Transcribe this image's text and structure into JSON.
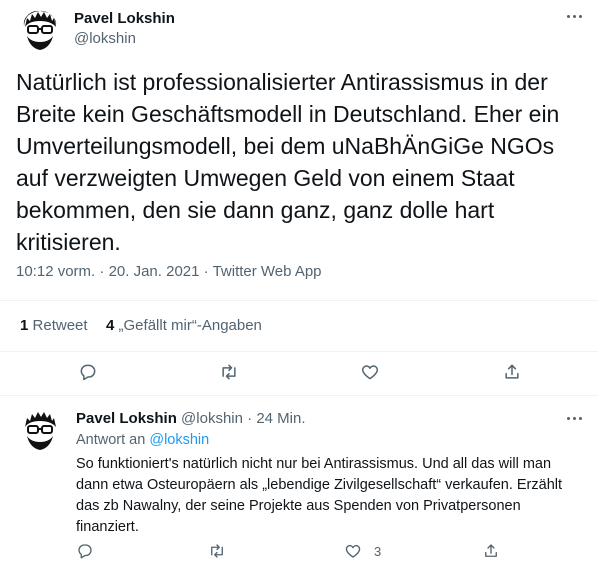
{
  "tweet": {
    "author_name": "Pavel Lokshin",
    "author_handle": "@lokshin",
    "text": "Natürlich ist professionalisierter Antirassismus in der Breite kein Geschäftsmodell in Deutschland. Eher ein Umverteilungsmodell, bei dem uNaBhÄnGiGe NGOs auf verzweigten Umwegen Geld von einem Staat bekommen, den sie dann ganz, ganz dolle hart kritisieren.",
    "time": "10:12 vorm.",
    "date": "20. Jan. 2021",
    "source": "Twitter Web App",
    "sep": "·",
    "retweet_count": "1",
    "retweet_label": "Retweet",
    "like_count": "4",
    "like_label": "„Gefällt mir“-Angaben"
  },
  "reply": {
    "author_name": "Pavel Lokshin",
    "author_handle": "@lokshin",
    "sep": "·",
    "age": "24 Min.",
    "reply_to_label": "Antwort an",
    "reply_to_handle": "@lokshin",
    "text": "So funktioniert's natürlich nicht nur bei Antirassismus. Und all das will man dann etwa Osteuropäern als „lebendige Zivilgesellschaft“ verkaufen. Erzählt das zb Nawalny, der seine Projekte aus Spenden von Privatpersonen finanziert.",
    "like_count": "3"
  },
  "icons": {
    "reply": "reply-icon",
    "retweet": "retweet-icon",
    "like": "heart-icon",
    "share": "share-icon",
    "more": "more-icon"
  },
  "colors": {
    "text": "#0f1419",
    "secondary": "#536471",
    "link": "#1d9bf0",
    "divider": "#eff3f4"
  }
}
